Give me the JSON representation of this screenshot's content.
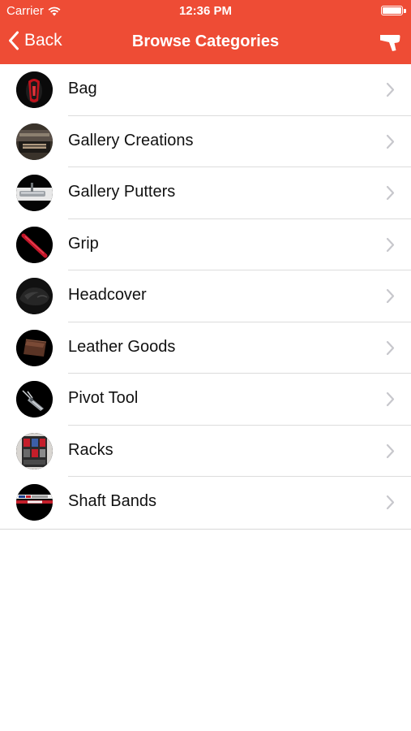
{
  "status_bar": {
    "carrier": "Carrier",
    "time": "12:36 PM"
  },
  "nav": {
    "back_label": "Back",
    "title": "Browse Categories",
    "right_icon": "putter-icon"
  },
  "colors": {
    "header_bg": "#ee4c35",
    "header_text": "#ffffff",
    "chevron": "#c7c7cc",
    "separator": "#dcdcdc"
  },
  "categories": [
    {
      "label": "Bag",
      "icon": "bag-thumbnail"
    },
    {
      "label": "Gallery Creations",
      "icon": "gallery-creations-thumbnail"
    },
    {
      "label": "Gallery Putters",
      "icon": "gallery-putters-thumbnail"
    },
    {
      "label": "Grip",
      "icon": "grip-thumbnail"
    },
    {
      "label": "Headcover",
      "icon": "headcover-thumbnail"
    },
    {
      "label": "Leather Goods",
      "icon": "leather-goods-thumbnail"
    },
    {
      "label": "Pivot Tool",
      "icon": "pivot-tool-thumbnail"
    },
    {
      "label": "Racks",
      "icon": "racks-thumbnail"
    },
    {
      "label": "Shaft Bands",
      "icon": "shaft-bands-thumbnail"
    }
  ]
}
